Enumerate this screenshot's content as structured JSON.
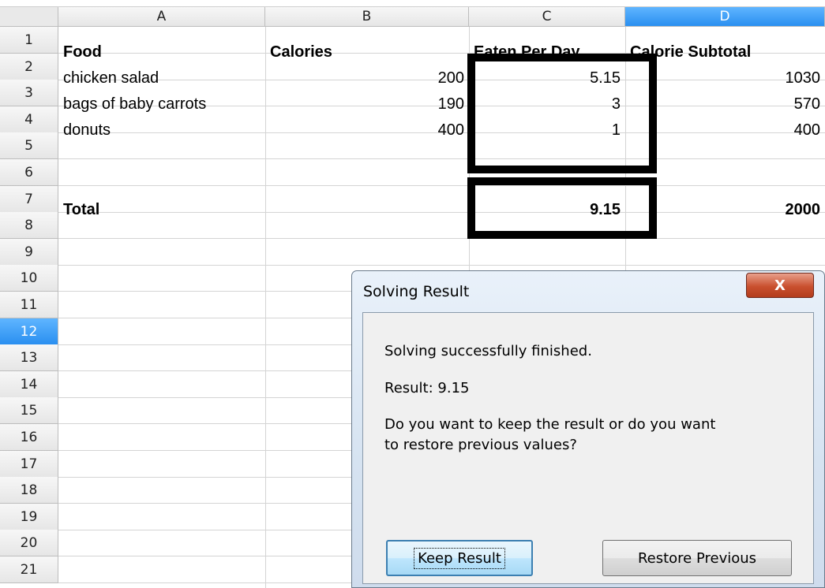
{
  "sheet": {
    "columns": [
      "A",
      "B",
      "C",
      "D"
    ],
    "selected_column": "D",
    "selected_row": "12",
    "rows": [
      "1",
      "2",
      "3",
      "4",
      "5",
      "6",
      "7",
      "8",
      "9",
      "10",
      "11",
      "12",
      "13",
      "14",
      "15",
      "16",
      "17",
      "18",
      "19",
      "20",
      "21"
    ],
    "cells": {
      "A1": "Food",
      "B1": "Calories",
      "C1": "Eaten Per Day",
      "D1": "Calorie Subtotal",
      "A2": "chicken salad",
      "B2": "200",
      "C2": "5.15",
      "D2": "1030",
      "A3": "bags of baby carrots",
      "B3": "190",
      "C3": "3",
      "D3": "570",
      "A4": "donuts",
      "B4": "400",
      "C4": "1",
      "D4": "400",
      "A7": "Total",
      "C7": "9.15",
      "D7": "2000"
    }
  },
  "dialog": {
    "title": "Solving Result",
    "close_label": "X",
    "message": "Solving successfully finished.",
    "result": "Result: 9.15",
    "question_line1": "Do you want to keep the result or do you want",
    "question_line2": "to restore previous values?",
    "keep_button": "Keep Result",
    "restore_button": "Restore Previous"
  }
}
